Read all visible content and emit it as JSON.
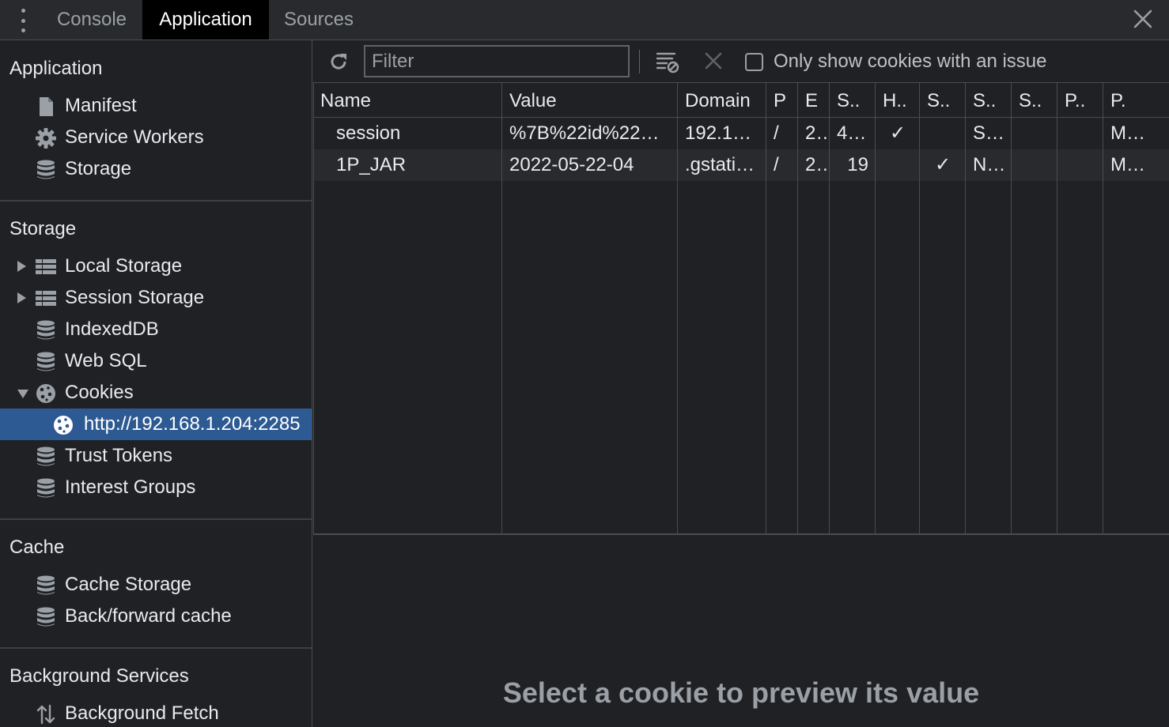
{
  "tabs": {
    "console": "Console",
    "application": "Application",
    "sources": "Sources"
  },
  "sidebar": {
    "application": {
      "title": "Application",
      "items": [
        {
          "label": "Manifest",
          "icon": "file-icon"
        },
        {
          "label": "Service Workers",
          "icon": "gear-icon"
        },
        {
          "label": "Storage",
          "icon": "database-icon"
        }
      ]
    },
    "storage": {
      "title": "Storage",
      "items": [
        {
          "label": "Local Storage",
          "icon": "table-icon",
          "expand": "collapsed"
        },
        {
          "label": "Session Storage",
          "icon": "table-icon",
          "expand": "collapsed"
        },
        {
          "label": "IndexedDB",
          "icon": "database-icon"
        },
        {
          "label": "Web SQL",
          "icon": "database-icon"
        },
        {
          "label": "Cookies",
          "icon": "cookie-icon",
          "expand": "expanded"
        },
        {
          "label": "http://192.168.1.204:2285",
          "icon": "cookie-icon",
          "selected": true
        },
        {
          "label": "Trust Tokens",
          "icon": "database-icon"
        },
        {
          "label": "Interest Groups",
          "icon": "database-icon"
        }
      ]
    },
    "cache": {
      "title": "Cache",
      "items": [
        {
          "label": "Cache Storage",
          "icon": "database-icon"
        },
        {
          "label": "Back/forward cache",
          "icon": "database-icon"
        }
      ]
    },
    "background": {
      "title": "Background Services",
      "items": [
        {
          "label": "Background Fetch",
          "icon": "arrows-up-down-icon"
        }
      ]
    }
  },
  "toolbar": {
    "filter_placeholder": "Filter",
    "issue_only_label": "Only show cookies with an issue",
    "issue_only_checked": false
  },
  "table": {
    "columns": [
      "Name",
      "Value",
      "Domain",
      "P",
      "E",
      "S..",
      "H..",
      "S..",
      "S..",
      "S..",
      "P..",
      "P."
    ],
    "rows": [
      [
        "session",
        "%7B%22id%22…",
        "192.1…",
        "/",
        "2…",
        "4…",
        "✓",
        "",
        "S…",
        "",
        "",
        "M…"
      ],
      [
        "1P_JAR",
        "2022-05-22-04",
        ".gstati…",
        "/",
        "2…",
        "19",
        "",
        "✓",
        "N…",
        "",
        "",
        "M…"
      ]
    ]
  },
  "preview": {
    "message": "Select a cookie to preview its value"
  },
  "colors": {
    "background": "#202124",
    "selection": "#2d5a92",
    "border": "#494c50",
    "text": "#e8eaed",
    "muted": "#9aa0a6"
  }
}
